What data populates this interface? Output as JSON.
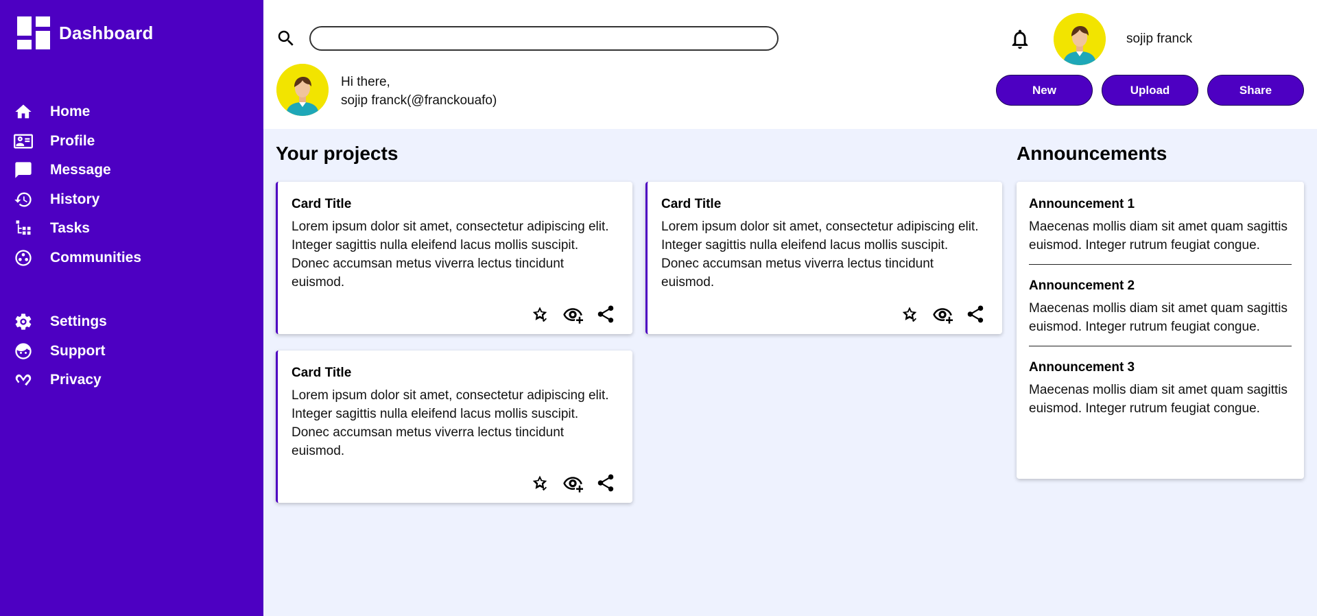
{
  "colors": {
    "sidebar_bg": "#4d00c2",
    "accent": "#4d00c2",
    "content_bg": "#eef2fe",
    "avatar_bg": "#f2e400"
  },
  "sidebar": {
    "brand": "Dashboard",
    "brand_icon": "dashboard-grid-icon",
    "primary_items": [
      {
        "label": "Home",
        "icon": "home-icon"
      },
      {
        "label": "Profile",
        "icon": "profile-card-icon"
      },
      {
        "label": "Message",
        "icon": "message-icon"
      },
      {
        "label": "History",
        "icon": "history-icon"
      },
      {
        "label": "Tasks",
        "icon": "tasks-icon"
      },
      {
        "label": "Communities",
        "icon": "communities-icon"
      }
    ],
    "secondary_items": [
      {
        "label": "Settings",
        "icon": "gear-icon"
      },
      {
        "label": "Support",
        "icon": "support-icon"
      },
      {
        "label": "Privacy",
        "icon": "privacy-icon"
      }
    ]
  },
  "header": {
    "search": {
      "value": "",
      "placeholder": ""
    },
    "username": "sojip franck",
    "greeting_line1": "Hi there,",
    "greeting_line2": "sojip franck(@franckouafo)",
    "actions": [
      "New",
      "Upload",
      "Share"
    ]
  },
  "projects": {
    "title": "Your projects",
    "cards": [
      {
        "title": "Card Title",
        "text": "Lorem ipsum dolor sit amet, consectetur adipiscing elit. Integer sagittis nulla eleifend lacus mollis suscipit. Donec accumsan metus viverra lectus tincidunt euismod."
      },
      {
        "title": "Card Title",
        "text": "Lorem ipsum dolor sit amet, consectetur adipiscing elit. Integer sagittis nulla eleifend lacus mollis suscipit. Donec accumsan metus viverra lectus tincidunt euismod."
      },
      {
        "title": "Card Title",
        "text": "Lorem ipsum dolor sit amet, consectetur adipiscing elit. Integer sagittis nulla eleifend lacus mollis suscipit. Donec accumsan metus viverra lectus tincidunt euismod."
      }
    ],
    "card_action_icons": [
      "star-check-icon",
      "eye-plus-icon",
      "share-icon"
    ]
  },
  "announcements": {
    "title": "Announcements",
    "items": [
      {
        "title": "Announcement 1",
        "text": "Maecenas mollis diam sit amet quam sagittis euismod. Integer rutrum feugiat congue."
      },
      {
        "title": "Announcement 2",
        "text": "Maecenas mollis diam sit amet quam sagittis euismod. Integer rutrum feugiat congue."
      },
      {
        "title": "Announcement 3",
        "text": "Maecenas mollis diam sit amet quam sagittis euismod. Integer rutrum feugiat congue."
      }
    ]
  }
}
